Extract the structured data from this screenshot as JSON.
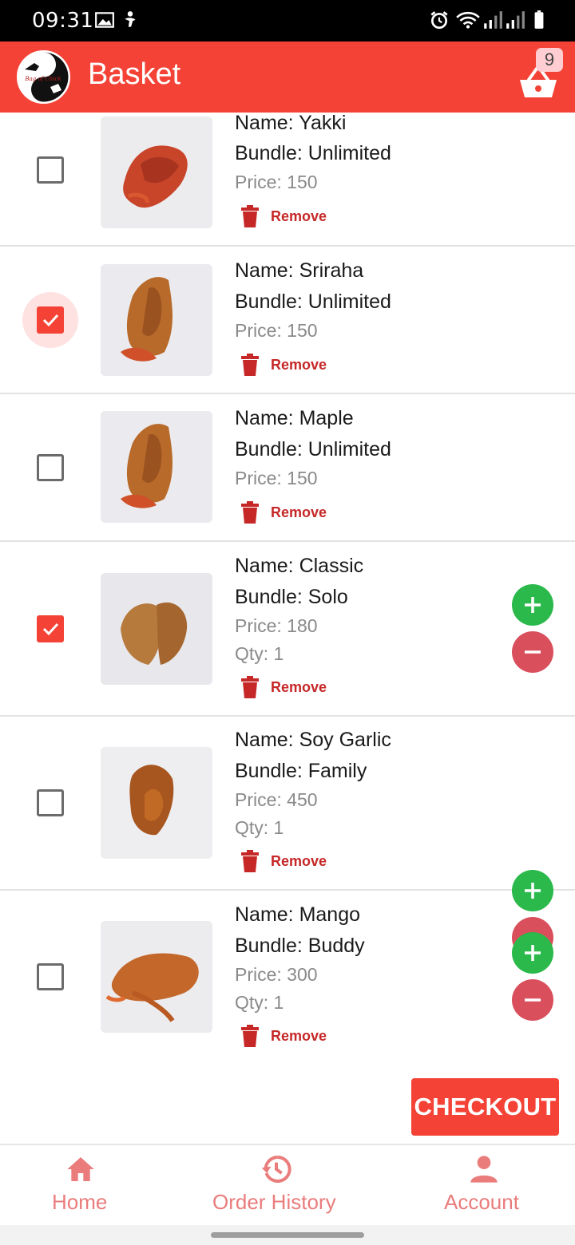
{
  "status_bar": {
    "time": "09:31",
    "icons": [
      "image-icon",
      "accessibility-icon",
      "alarm-icon",
      "wifi-icon",
      "signal-icon",
      "signal-icon",
      "battery-icon"
    ]
  },
  "app_bar": {
    "title": "Basket",
    "logo_text": "Bag of Chick",
    "basket_count": "9",
    "colors": {
      "primary": "#f44336"
    }
  },
  "items": [
    {
      "name": "Name: Yakki",
      "bundle": "Bundle: Unlimited",
      "price": "Price: 150",
      "qty": null,
      "checked": false,
      "focused": false,
      "remove_label": "Remove"
    },
    {
      "name": "Name: Sriraha",
      "bundle": "Bundle: Unlimited",
      "price": "Price: 150",
      "qty": null,
      "checked": true,
      "focused": true,
      "remove_label": "Remove"
    },
    {
      "name": "Name: Maple",
      "bundle": "Bundle: Unlimited",
      "price": "Price: 150",
      "qty": null,
      "checked": false,
      "focused": false,
      "remove_label": "Remove"
    },
    {
      "name": "Name: Classic",
      "bundle": "Bundle: Solo",
      "price": "Price: 180",
      "qty": "Qty: 1",
      "checked": true,
      "focused": false,
      "remove_label": "Remove"
    },
    {
      "name": "Name: Soy Garlic",
      "bundle": "Bundle: Family",
      "price": "Price: 450",
      "qty": "Qty: 1",
      "checked": false,
      "focused": false,
      "remove_label": "Remove"
    },
    {
      "name": "Name: Mango",
      "bundle": "Bundle: Buddy",
      "price": "Price: 300",
      "qty": "Qty: 1",
      "checked": false,
      "focused": false,
      "remove_label": "Remove"
    }
  ],
  "checkout_label": "CHECKOUT",
  "bottom_nav": {
    "home": "Home",
    "order_history": "Order History",
    "account": "Account"
  }
}
